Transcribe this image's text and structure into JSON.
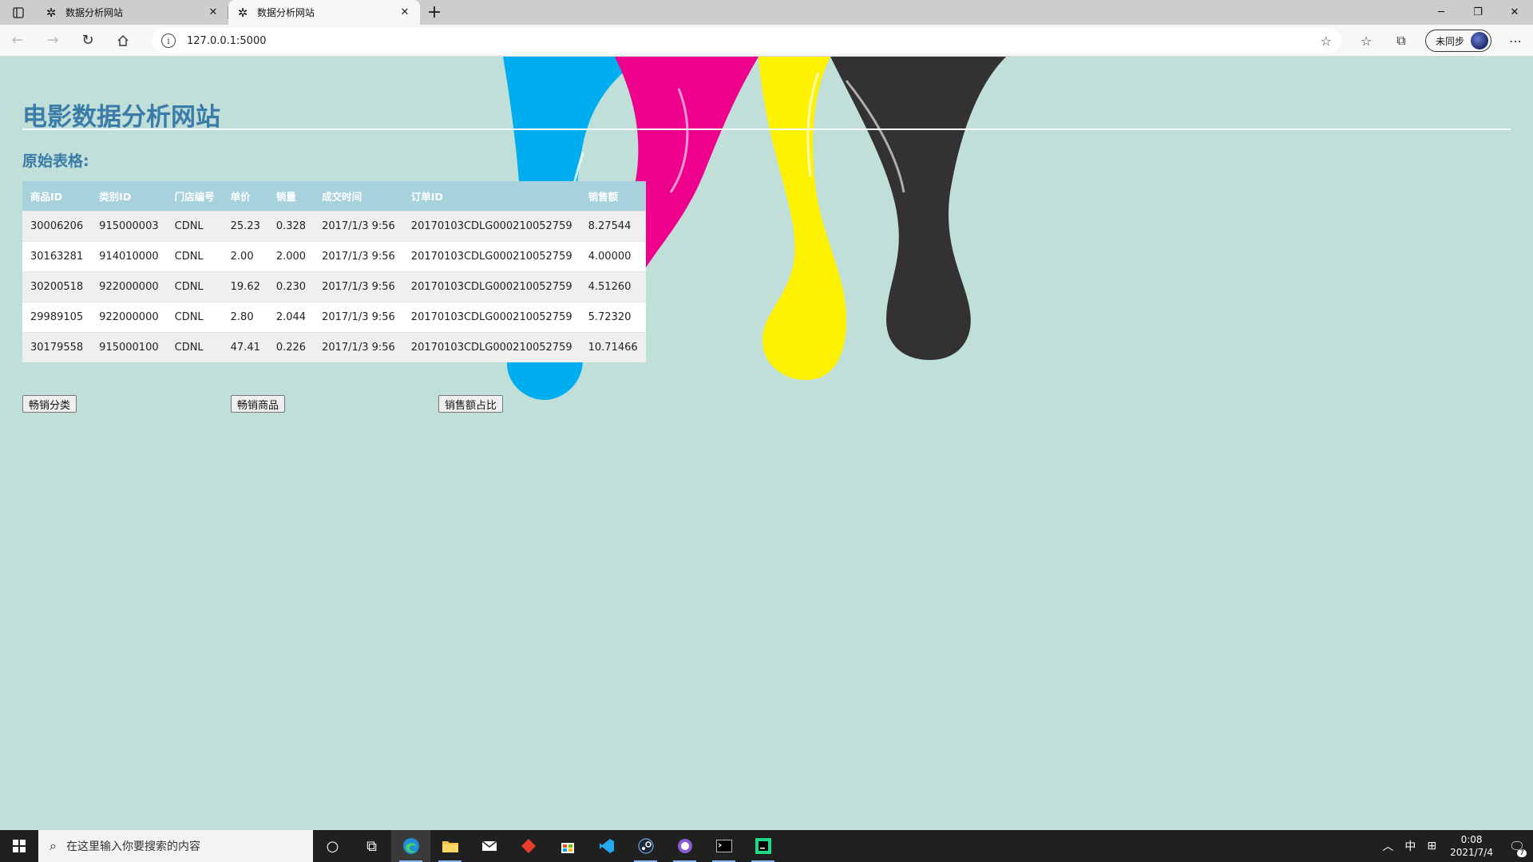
{
  "browser": {
    "tabs": [
      {
        "title": "数据分析网站",
        "active": false
      },
      {
        "title": "数据分析网站",
        "active": true
      }
    ],
    "url": "127.0.0.1:5000",
    "profile_label": "未同步"
  },
  "page": {
    "title": "电影数据分析网站",
    "subheading": "原始表格:",
    "table": {
      "headers": [
        "商品ID",
        "类别ID",
        "门店编号",
        "单价",
        "销量",
        "成交时间",
        "订单ID",
        "销售额"
      ],
      "rows": [
        [
          "30006206",
          "915000003",
          "CDNL",
          "25.23",
          "0.328",
          "2017/1/3 9:56",
          "20170103CDLG000210052759",
          "8.27544"
        ],
        [
          "30163281",
          "914010000",
          "CDNL",
          "2.00",
          "2.000",
          "2017/1/3 9:56",
          "20170103CDLG000210052759",
          "4.00000"
        ],
        [
          "30200518",
          "922000000",
          "CDNL",
          "19.62",
          "0.230",
          "2017/1/3 9:56",
          "20170103CDLG000210052759",
          "4.51260"
        ],
        [
          "29989105",
          "922000000",
          "CDNL",
          "2.80",
          "2.044",
          "2017/1/3 9:56",
          "20170103CDLG000210052759",
          "5.72320"
        ],
        [
          "30179558",
          "915000100",
          "CDNL",
          "47.41",
          "0.226",
          "2017/1/3 9:56",
          "20170103CDLG000210052759",
          "10.71466"
        ]
      ]
    },
    "buttons": {
      "top_categories": "畅销分类",
      "top_products": "畅销商品",
      "sales_share": "销售额占比"
    },
    "colors": {
      "background": "#c0dfd9",
      "title": "#3b7ba8",
      "table_header": "#a7d1dc",
      "paint_cyan": "#00aeef",
      "paint_magenta": "#ec008c",
      "paint_yellow": "#fff200",
      "paint_black": "#333132"
    }
  },
  "taskbar": {
    "search_placeholder": "在这里输入你要搜索的内容",
    "ime": "中",
    "time": "0:08",
    "date": "2021/7/4",
    "notification_count": "7",
    "apps": [
      "task-view",
      "edge",
      "file-explorer",
      "mail",
      "office",
      "store",
      "vscode",
      "steam",
      "github-desktop",
      "terminal",
      "pycharm"
    ]
  }
}
